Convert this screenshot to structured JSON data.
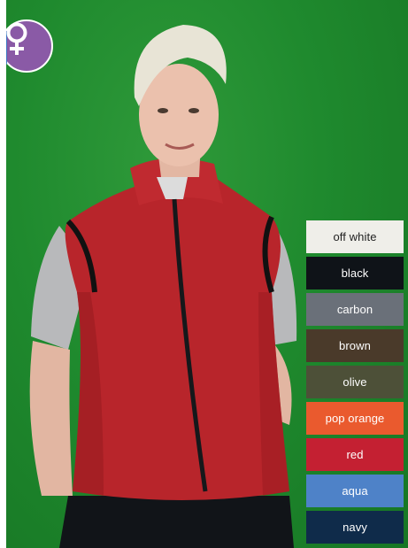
{
  "badge": {
    "icon": "female-symbol-icon",
    "color": "#8a5aa6"
  },
  "colors": [
    {
      "label": "off white",
      "bg": "#efeee9",
      "fg": "#222222"
    },
    {
      "label": "black",
      "bg": "#0f1318",
      "fg": "#ffffff"
    },
    {
      "label": "carbon",
      "bg": "#6a7079",
      "fg": "#ffffff"
    },
    {
      "label": "brown",
      "bg": "#4a3a2a",
      "fg": "#ffffff"
    },
    {
      "label": "olive",
      "bg": "#4d5038",
      "fg": "#ffffff"
    },
    {
      "label": "pop orange",
      "bg": "#ea5a2e",
      "fg": "#ffffff"
    },
    {
      "label": "red",
      "bg": "#c42032",
      "fg": "#ffffff"
    },
    {
      "label": "aqua",
      "bg": "#4e82c8",
      "fg": "#ffffff"
    },
    {
      "label": "navy",
      "bg": "#0f2b4a",
      "fg": "#ffffff"
    }
  ]
}
